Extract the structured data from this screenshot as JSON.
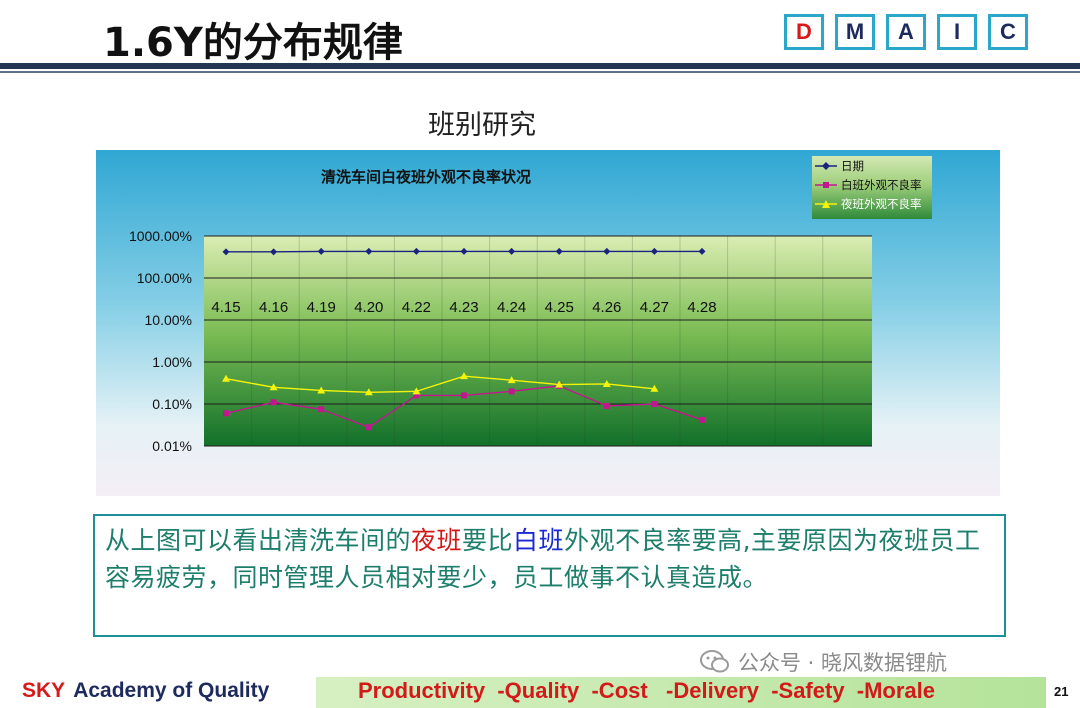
{
  "slide": {
    "title": "1.6Y的分布规律",
    "subtitle": "班别研究",
    "dmaic": [
      {
        "letter": "D",
        "active": true
      },
      {
        "letter": "M",
        "active": false
      },
      {
        "letter": "A",
        "active": false
      },
      {
        "letter": "I",
        "active": false
      },
      {
        "letter": "C",
        "active": false
      }
    ]
  },
  "chart_data": {
    "type": "line",
    "title": "清洗车间白夜班外观不良率状况",
    "y_scale": "log",
    "ylim": [
      0.0001,
      10
    ],
    "yticks": [
      "1000.00%",
      "100.00%",
      "10.00%",
      "1.00%",
      "0.10%",
      "0.01%"
    ],
    "categories": [
      "4.15",
      "4.16",
      "4.19",
      "4.20",
      "4.22",
      "4.23",
      "4.24",
      "4.25",
      "4.26",
      "4.27",
      "4.28"
    ],
    "legend_position": "top-right",
    "grid": true,
    "series": [
      {
        "name": "日期",
        "color": "#1a237e",
        "marker": "diamond",
        "values": [
          4.2,
          4.2,
          4.3,
          4.3,
          4.3,
          4.3,
          4.3,
          4.3,
          4.3,
          4.3,
          4.3
        ]
      },
      {
        "name": "白班外观不良率",
        "color": "#c2188f",
        "marker": "square",
        "values": [
          0.0006,
          0.0011,
          0.00075,
          0.00028,
          0.0016,
          0.0016,
          0.002,
          0.0027,
          0.0009,
          0.001,
          0.00042
        ]
      },
      {
        "name": "夜班外观不良率",
        "color": "#f4f40a",
        "marker": "triangle",
        "values": [
          0.004,
          0.0025,
          0.0021,
          0.0019,
          0.002,
          0.0046,
          0.0037,
          0.0029,
          0.003,
          0.0023,
          null
        ]
      }
    ]
  },
  "conclusion": {
    "part1": "从上图可以看出清洗车间的",
    "night": "夜班",
    "part2": "要比",
    "day": "白班",
    "part3": "外观不良率要高,主要原因为夜班员工容易疲劳，同时管理人员相对要少，员工做事不认真造成。"
  },
  "footer": {
    "sky": "SKY",
    "academy": "Academy of Quality",
    "slogan": "Productivity  -Quality  -Cost   -Delivery  -Safety  -Morale",
    "page": "21",
    "watermark": "公众号 · 晓风数据锂航"
  }
}
